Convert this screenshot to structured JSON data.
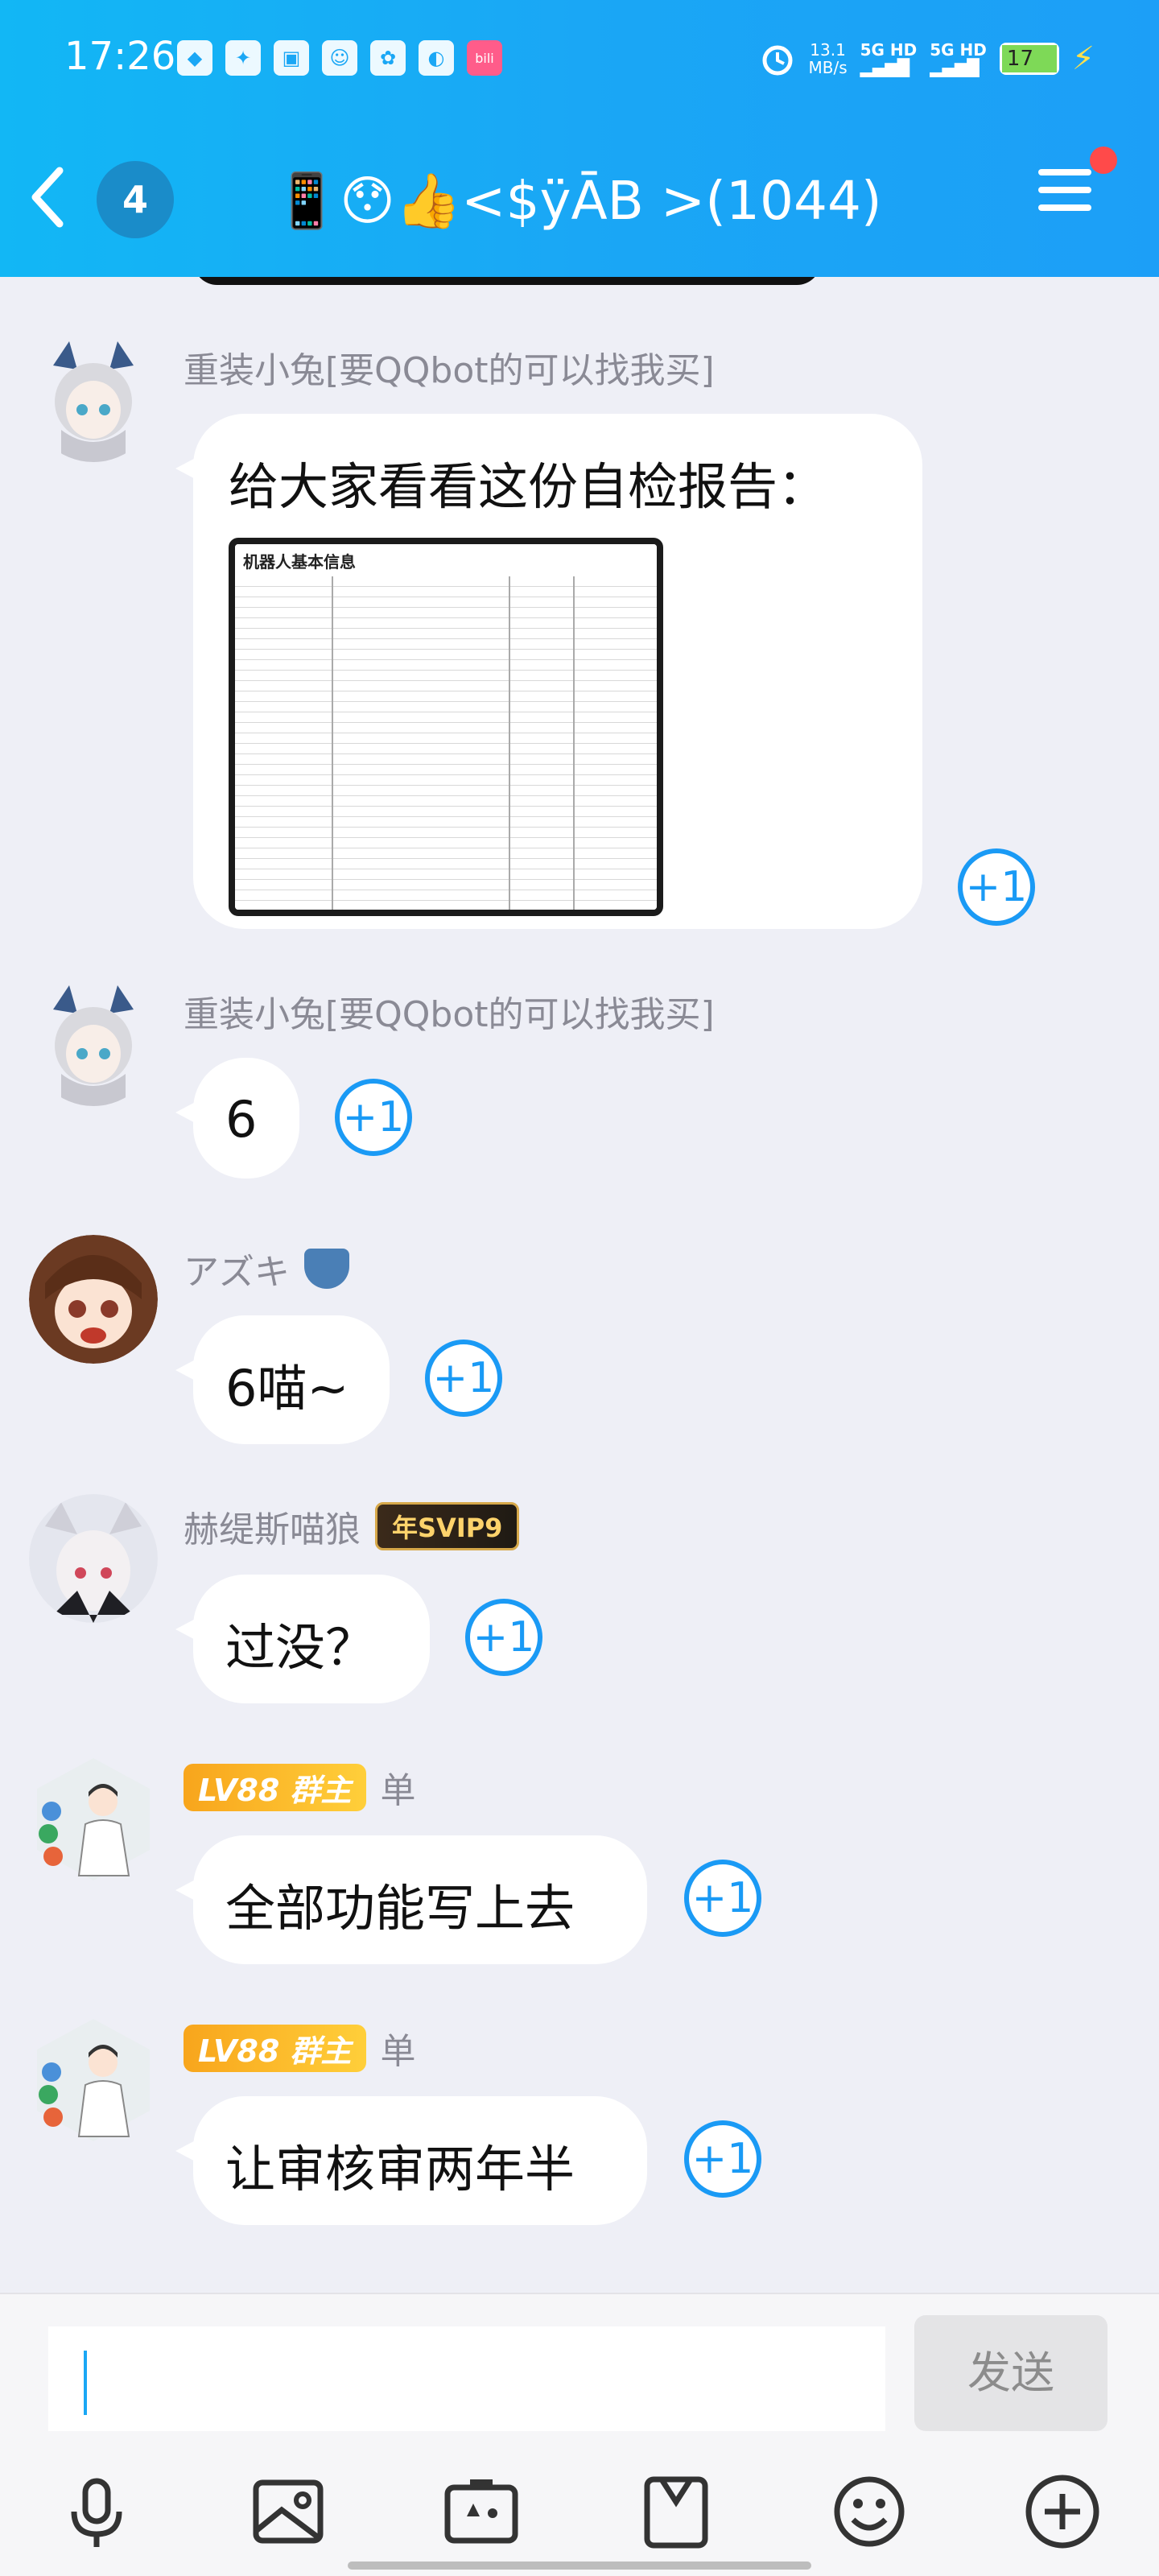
{
  "status_bar": {
    "time": "17:26",
    "net_speed_value": "13.1",
    "net_speed_unit": "MB/s",
    "network_1": "5G HD",
    "network_2": "5G HD",
    "battery_level": "17"
  },
  "nav": {
    "unread_count": "4",
    "chat_title": "📱😯👍<$ÿĀB >(1044)"
  },
  "messages": [
    {
      "sender": "重装小兔[要QQbot的可以找我买]",
      "text": "给大家看看这份自检报告：",
      "image_title": "机器人基本信息",
      "plus_one": "+1"
    },
    {
      "sender": "重装小兔[要QQbot的可以找我买]",
      "text": "6",
      "plus_one": "+1"
    },
    {
      "sender": "アズキ",
      "text": "6喵~",
      "plus_one": "+1"
    },
    {
      "sender": "赫缇斯喵狼",
      "badge": "年SVIP9",
      "text": "过没？",
      "plus_one": "+1"
    },
    {
      "sender": "单",
      "level_badge": "LV88 群主",
      "text": "全部功能写上去",
      "plus_one": "+1"
    },
    {
      "sender": "单",
      "level_badge": "LV88 群主",
      "text": "让审核审两年半",
      "plus_one": "+1"
    }
  ],
  "input": {
    "value": "",
    "send_label": "发送"
  },
  "toolbar": {
    "icons": [
      "microphone-icon",
      "image-icon",
      "camera-icon",
      "file-icon",
      "emoji-icon",
      "plus-icon"
    ]
  },
  "colors": {
    "header": "#1aa7f5",
    "accent": "#1a9af5",
    "background": "#eeeff6",
    "bubble": "#ffffff"
  }
}
